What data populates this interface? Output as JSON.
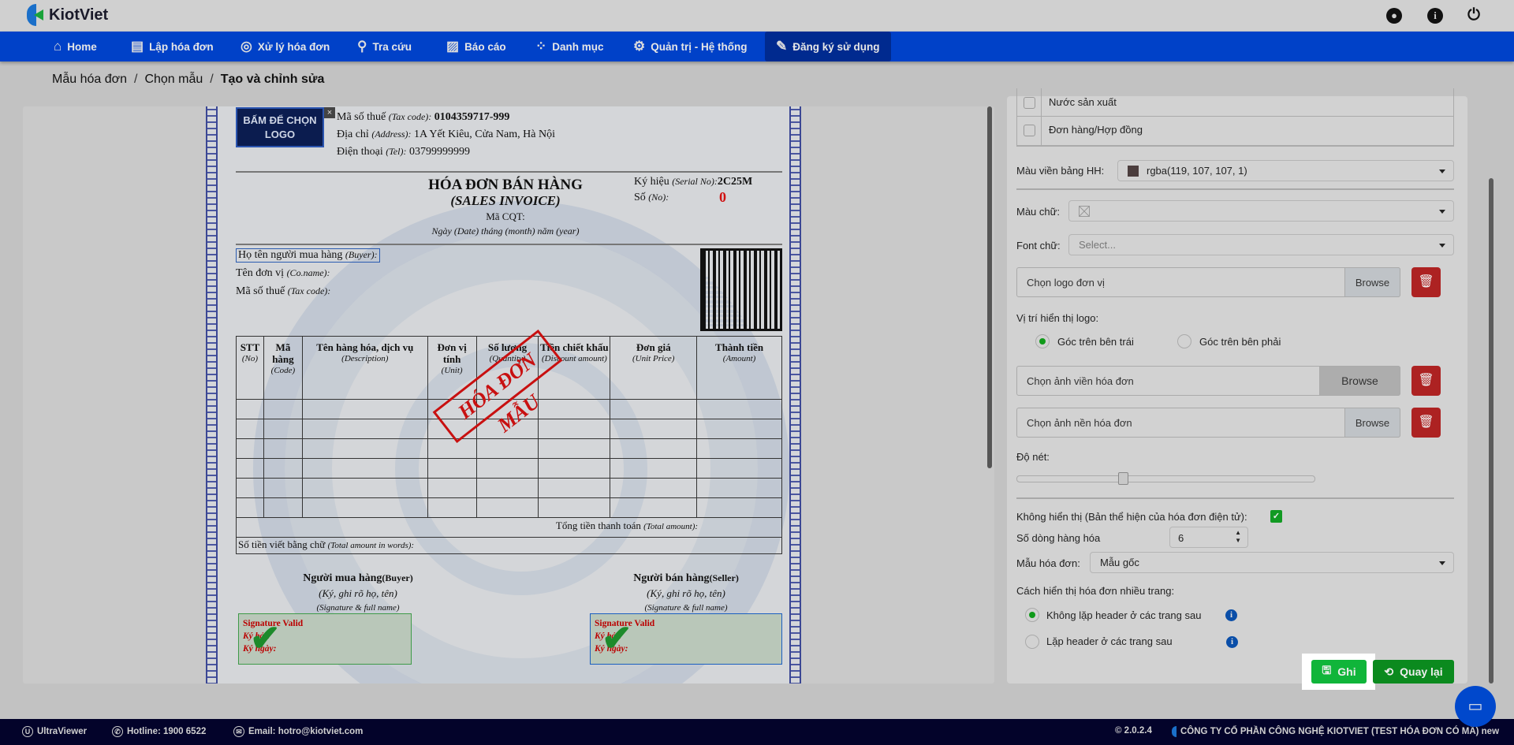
{
  "app": {
    "name": "KiotViet"
  },
  "header_icons": [
    "user-icon",
    "info-icon",
    "power-icon"
  ],
  "nav": [
    {
      "label": "Home",
      "icon": "home-icon"
    },
    {
      "label": "Lập hóa đơn",
      "icon": "create-invoice-icon"
    },
    {
      "label": "Xử lý hóa đơn",
      "icon": "process-invoice-icon"
    },
    {
      "label": "Tra cứu",
      "icon": "search-icon"
    },
    {
      "label": "Báo cáo",
      "icon": "report-icon"
    },
    {
      "label": "Danh mục",
      "icon": "category-icon"
    },
    {
      "label": "Quản trị - Hệ thống",
      "icon": "admin-icon"
    },
    {
      "label": "Đăng ký sử dụng",
      "icon": "register-icon",
      "active": true
    }
  ],
  "breadcrumb": [
    "Mẫu hóa đơn",
    "Chọn mẫu",
    "Tạo và chỉnh sửa"
  ],
  "invoice": {
    "logo_placeholder": "BẤM ĐỂ CHỌN LOGO",
    "logo_close": "×",
    "tax_code_label": "Mã số thuế",
    "tax_code_en": "(Tax code):",
    "tax_code": "0104359717-999",
    "address_label": "Địa chỉ",
    "address_en": "(Address):",
    "address": "1A Yết Kiêu, Cửa Nam, Hà Nội",
    "phone_label": "Điện thoại",
    "phone_en": "(Tel):",
    "phone": "03799999999",
    "title": "HÓA ĐƠN BÁN HÀNG",
    "subtitle": "(SALES INVOICE)",
    "cqt": "Mã CQT:",
    "date_line": "Ngày (Date)  tháng (month)  năm (year)",
    "serial_label": "Ký hiệu",
    "serial_en": "(Serial No):",
    "serial": "2C25M",
    "no_label": "Số",
    "no_en": "(No):",
    "no": "0",
    "buyer_label": "Họ tên người mua hàng",
    "buyer_en": "(Buyer):",
    "company_label": "Tên đơn vị",
    "company_en": "(Co.name):",
    "buyer_tax_label": "Mã số thuế",
    "buyer_tax_en": "(Tax code):",
    "columns": [
      {
        "vn": "STT",
        "en": "(No)"
      },
      {
        "vn": "Mã hàng",
        "en": "(Code)"
      },
      {
        "vn": "Tên hàng hóa, dịch vụ",
        "en": "(Description)"
      },
      {
        "vn": "Đơn vị tính",
        "en": "(Unit)"
      },
      {
        "vn": "Số lượng",
        "en": "(Quantity)"
      },
      {
        "vn": "Tiền chiết khấu",
        "en": "(Discount amount)"
      },
      {
        "vn": "Đơn giá",
        "en": "(Unit Price)"
      },
      {
        "vn": "Thành tiền",
        "en": "(Amount)"
      }
    ],
    "row_count": 6,
    "total_label": "Tổng tiền thanh toán",
    "total_en": "(Total amount):",
    "words_label": "Số tiền viết bằng chữ",
    "words_en": "(Total amount in words):",
    "stamp": "HÓA ĐƠN MẪU",
    "buyer_sign": {
      "title": "Người mua hàng",
      "title_en": "(Buyer)",
      "l2": "(Ký, ghi rõ họ, tên)",
      "l3": "(Signature & full name)"
    },
    "seller_sign": {
      "title": "Người bán hàng",
      "title_en": "(Seller)",
      "l2": "(Ký, ghi rõ họ, tên)",
      "l3": "(Signature & full name)"
    },
    "sig": {
      "valid": "Signature Valid",
      "by": "Ký bởi:",
      "date": "Ký ngày:"
    }
  },
  "settings": {
    "fields": [
      {
        "label": "Nước sản xuất",
        "checked": false
      },
      {
        "label": "Đơn hàng/Hợp đồng",
        "checked": false
      }
    ],
    "border_color_label": "Màu viền bảng HH:",
    "border_color_value": "rgba(119, 107, 107, 1)",
    "border_swatch": "#776b6b",
    "text_color_label": "Màu chữ:",
    "font_label": "Font chữ:",
    "font_placeholder": "Select...",
    "logo_file": "Chọn logo đơn vị",
    "browse": "Browse",
    "logo_pos_label": "Vị trí hiển thị logo:",
    "logo_pos_left": "Góc trên bên trái",
    "logo_pos_right": "Góc trên bên phải",
    "logo_pos_selected": "left",
    "border_file": "Chọn ảnh viền hóa đơn",
    "bg_file": "Chọn ảnh nền hóa đơn",
    "sharpness_label": "Độ nét:",
    "sharpness_value": 0.35,
    "hide_label": "Không hiển thị (Bản thể hiện của hóa đơn điện tử):",
    "hide_checked": true,
    "rows_label": "Số dòng hàng hóa",
    "rows_value": "6",
    "template_label": "Mẫu hóa đơn:",
    "template_value": "Mẫu gốc",
    "multipage_label": "Cách hiển thị hóa đơn nhiều trang:",
    "multipage_opt1": "Không lặp header ở các trang sau",
    "multipage_opt2": "Lặp header ở các trang sau",
    "multipage_selected": 1,
    "save": "Ghi",
    "back": "Quay lại"
  },
  "footer": {
    "ultraviewer": "UltraViewer",
    "hotline": "Hotline: 1900 6522",
    "email": "Email: hotro@kiotviet.com",
    "version": "© 2.0.2.4",
    "company": "CÔNG TY CỔ PHẦN CÔNG NGHỆ KIOTVIET (TEST HÓA ĐƠN CÓ MÃ) new"
  },
  "colors": {
    "nav": "#0041c8",
    "save": "#10b53a",
    "back": "#0b8a1e",
    "danger": "#ad2222"
  }
}
